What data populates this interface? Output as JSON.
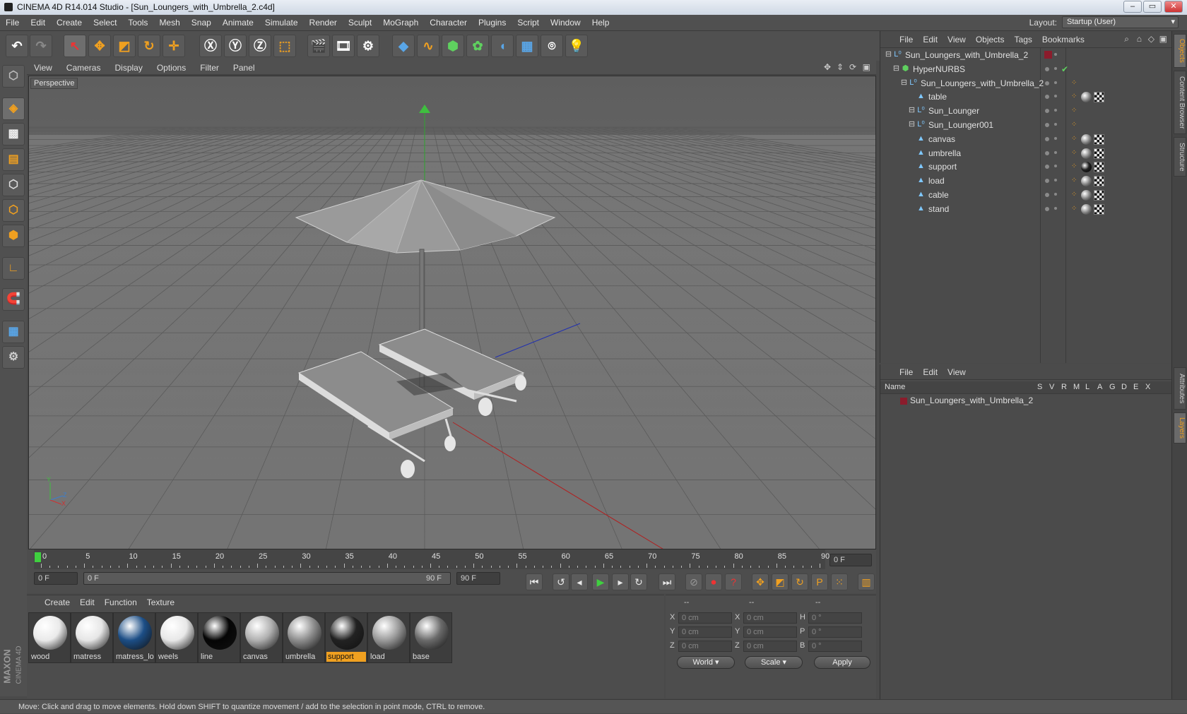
{
  "window": {
    "title": "CINEMA 4D R14.014 Studio - [Sun_Loungers_with_Umbrella_2.c4d]",
    "min": "–",
    "max": "▭",
    "close": "✕"
  },
  "menu": [
    "File",
    "Edit",
    "Create",
    "Select",
    "Tools",
    "Mesh",
    "Snap",
    "Animate",
    "Simulate",
    "Render",
    "Sculpt",
    "MoGraph",
    "Character",
    "Plugins",
    "Script",
    "Window",
    "Help"
  ],
  "layout": {
    "label": "Layout:",
    "value": "Startup (User)"
  },
  "viewport": {
    "menu": [
      "View",
      "Cameras",
      "Display",
      "Options",
      "Filter",
      "Panel"
    ],
    "label": "Perspective",
    "axis_x": "X",
    "axis_y": "Y",
    "axis_z": "Z"
  },
  "timeline": {
    "ticks": [
      "0",
      "5",
      "10",
      "15",
      "20",
      "25",
      "30",
      "35",
      "40",
      "45",
      "50",
      "55",
      "60",
      "65",
      "70",
      "75",
      "80",
      "85",
      "90"
    ],
    "current_frame": "0 F",
    "start": "0 F",
    "range_start": "0 F",
    "range_end": "90 F",
    "end": "90 F"
  },
  "materials": {
    "menu": [
      "Create",
      "Edit",
      "Function",
      "Texture"
    ],
    "items": [
      {
        "name": "wood",
        "color": "#eaeaea"
      },
      {
        "name": "matress",
        "color": "#e6e6e6"
      },
      {
        "name": "matress_lo",
        "color": "#1c4e86"
      },
      {
        "name": "weels",
        "color": "#e8e8e8"
      },
      {
        "name": "line",
        "color": "#050505"
      },
      {
        "name": "canvas",
        "color": "#b0b0b0"
      },
      {
        "name": "umbrella",
        "color": "#8d8d8d"
      },
      {
        "name": "support",
        "color": "#222222",
        "selected": true
      },
      {
        "name": "load",
        "color": "#9a9a9a"
      },
      {
        "name": "base",
        "color": "#6a6a6a"
      }
    ]
  },
  "coords": {
    "header": [
      "--",
      "--",
      "--"
    ],
    "rows": [
      {
        "a": "X",
        "av": "0 cm",
        "b": "X",
        "bv": "0 cm",
        "c": "H",
        "cv": "0 °"
      },
      {
        "a": "Y",
        "av": "0 cm",
        "b": "Y",
        "bv": "0 cm",
        "c": "P",
        "cv": "0 °"
      },
      {
        "a": "Z",
        "av": "0 cm",
        "b": "Z",
        "bv": "0 cm",
        "c": "B",
        "cv": "0 °"
      }
    ],
    "mode1": "World",
    "mode2": "Scale",
    "apply": "Apply"
  },
  "objects": {
    "menu": [
      "File",
      "Edit",
      "View",
      "Objects",
      "Tags",
      "Bookmarks"
    ],
    "rows": [
      {
        "name": "Sun_Loungers_with_Umbrella_2",
        "indent": 0,
        "icon": "L0",
        "tags": "red"
      },
      {
        "name": "HyperNURBS",
        "indent": 1,
        "icon": "hn",
        "tags": "check"
      },
      {
        "name": "Sun_Loungers_with_Umbrella_2",
        "indent": 2,
        "icon": "L0",
        "tags": "org"
      },
      {
        "name": "table",
        "indent": 3,
        "icon": "poly",
        "tags": "full"
      },
      {
        "name": "Sun_Lounger",
        "indent": 3,
        "icon": "L0",
        "tags": "org"
      },
      {
        "name": "Sun_Lounger001",
        "indent": 3,
        "icon": "L0",
        "tags": "org"
      },
      {
        "name": "canvas",
        "indent": 3,
        "icon": "poly",
        "tags": "full"
      },
      {
        "name": "umbrella",
        "indent": 3,
        "icon": "poly",
        "tags": "full"
      },
      {
        "name": "support",
        "indent": 3,
        "icon": "poly",
        "tags": "fulldark"
      },
      {
        "name": "load",
        "indent": 3,
        "icon": "poly",
        "tags": "full"
      },
      {
        "name": "cable",
        "indent": 3,
        "icon": "poly",
        "tags": "full"
      },
      {
        "name": "stand",
        "indent": 3,
        "icon": "poly",
        "tags": "full"
      }
    ]
  },
  "layers": {
    "menu": [
      "File",
      "Edit",
      "View"
    ],
    "name_header": "Name",
    "columns": [
      "S",
      "V",
      "R",
      "M",
      "L",
      "A",
      "G",
      "D",
      "E",
      "X"
    ],
    "row": "Sun_Loungers_with_Umbrella_2"
  },
  "sidetabs": [
    "Objects",
    "Content Browser",
    "Structure",
    "Attributes",
    "Layers"
  ],
  "status": "Move: Click and drag to move elements. Hold down SHIFT to quantize movement / add to the selection in point mode, CTRL to remove.",
  "brand": {
    "line1": "MAXON",
    "line2": "CINEMA 4D"
  }
}
